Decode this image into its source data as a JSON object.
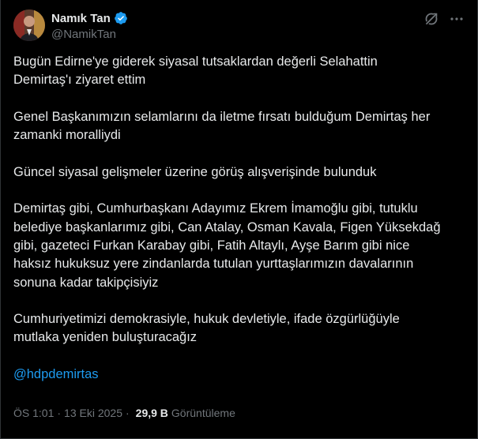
{
  "author": {
    "display_name": "Namık Tan",
    "handle": "@NamikTan",
    "verified": true
  },
  "icons": {
    "avatar": "profile-photo",
    "verified": "verified-badge-icon",
    "grok": "grok-icon",
    "more": "more-horizontal-icon"
  },
  "colors": {
    "background": "#000000",
    "text": "#e7e9ea",
    "secondary_text": "#71767b",
    "accent": "#1d9bf0"
  },
  "tweet": {
    "paragraphs": [
      "Bugün Edirne'ye giderek siyasal tutsaklardan değerli Selahattin\nDemirtaş'ı ziyaret ettim",
      "Genel Başkanımızın selamlarını da iletme fırsatı bulduğum Demirtaş her\nzamanki moralliydi",
      "Güncel siyasal gelişmeler üzerine görüş alışverişinde bulunduk",
      "Demirtaş gibi, Cumhurbaşkanı Adayımız Ekrem İmamoğlu gibi, tutuklu\nbelediye başkanlarımız gibi, Can Atalay, Osman Kavala, Figen Yüksekdağ\ngibi, gazeteci Furkan Karabay gibi, Fatih Altaylı, Ayşe Barım gibi nice\nhaksız hukuksuz yere zindanlarda tutulan yurttaşlarımızın davalarının\nsonuna kadar takipçisiyiz",
      "Cumhuriyetimizi demokrasiyle, hukuk devletiyle, ifade özgürlüğüyle\nmutlaka yeniden buluşturacağız"
    ],
    "mention": "@hdpdemirtas"
  },
  "meta": {
    "time": "ÖS 1:01",
    "separator": "·",
    "date": "13 Eki 2025",
    "views_count": "29,9 B",
    "views_label": "Görüntüleme"
  }
}
